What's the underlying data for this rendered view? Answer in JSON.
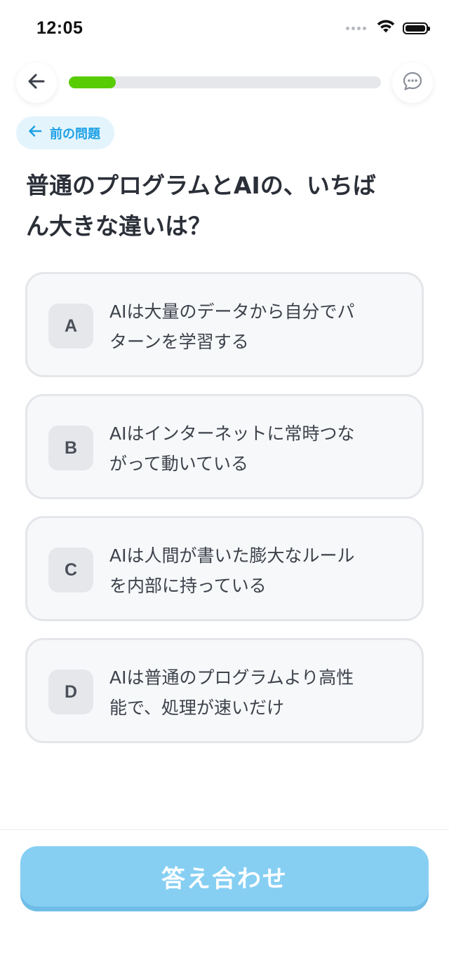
{
  "status_bar": {
    "time": "12:05",
    "icons": [
      "signal-dots-icon",
      "wifi-icon",
      "battery-icon"
    ]
  },
  "header": {
    "back_icon": "arrow-left-icon",
    "chat_icon": "chat-bubble-icon",
    "progress_fraction": 0.15,
    "progress_color": "#58cc02"
  },
  "prev_button": {
    "icon": "arrow-left-icon",
    "label": "前の問題"
  },
  "question": {
    "line1": "普通のプログラムとAIの、いちば",
    "line2": "ん大きな違いは？"
  },
  "options": [
    {
      "letter": "A",
      "line1": "AIは大量のデータから自分でパ",
      "line2": "ターンを学習する"
    },
    {
      "letter": "B",
      "line1": "AIはインターネットに常時つな",
      "line2": "がって動いている"
    },
    {
      "letter": "C",
      "line1": "AIは人間が書いた膨大なルール",
      "line2": "を内部に持っている"
    },
    {
      "letter": "D",
      "line1": "AIは普通のプログラムより高性",
      "line2": "能で、処理が速いだけ"
    }
  ],
  "submit": {
    "label": "答え合わせ",
    "color": "#86cff3"
  }
}
